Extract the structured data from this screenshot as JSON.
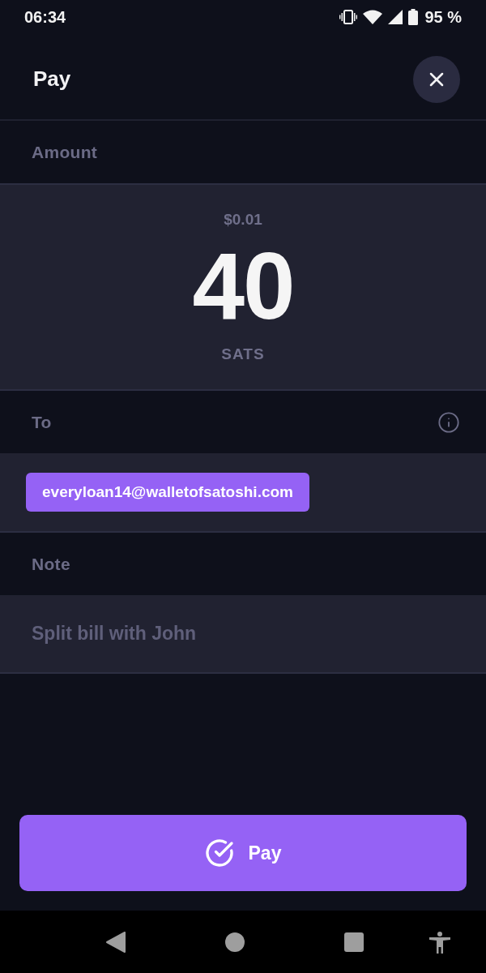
{
  "status_bar": {
    "time": "06:34",
    "battery": "95 %"
  },
  "header": {
    "title": "Pay"
  },
  "amount": {
    "label": "Amount",
    "fiat": "$0.01",
    "value": "40",
    "unit": "SATS"
  },
  "recipient": {
    "label": "To",
    "address": "everyloan14@walletofsatoshi.com"
  },
  "note": {
    "label": "Note",
    "placeholder": "Split bill with John"
  },
  "pay_button": {
    "label": "Pay"
  }
}
